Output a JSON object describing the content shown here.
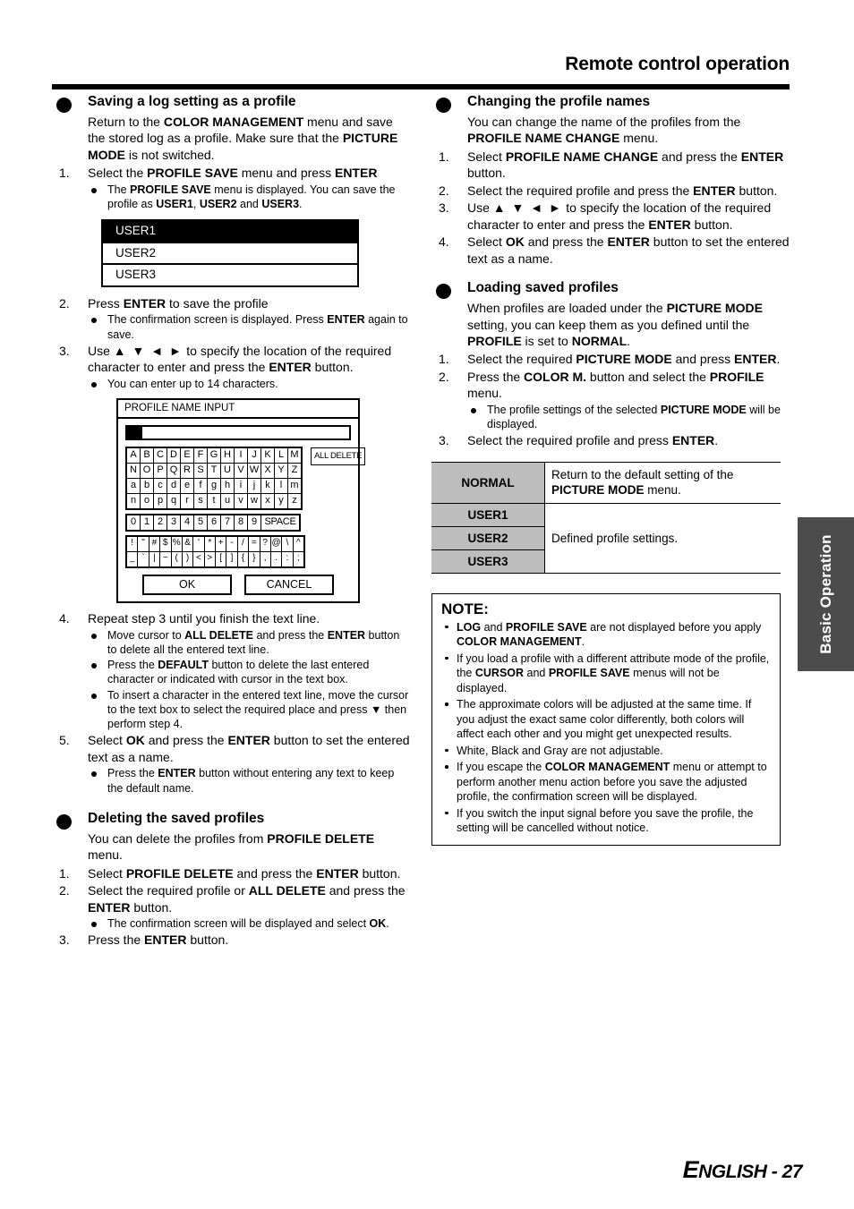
{
  "header": {
    "title": "Remote control operation"
  },
  "footer": {
    "lang_initial": "E",
    "lang_rest": "NGLISH",
    "separator": " - ",
    "page_number": "27"
  },
  "side_tab": {
    "label": "Basic Operation",
    "background": "#4c4c4c",
    "text_color": "#ffffff"
  },
  "left_column": {
    "section_saving": {
      "title": "Saving a log setting as a profile",
      "intro_1": "Return to the ",
      "intro_bold_1": "COLOR MANAGEMENT",
      "intro_2": " menu and save the stored log as a profile. Make sure that the ",
      "intro_bold_2": "PICTURE MODE",
      "intro_3": " is not switched.",
      "step1": {
        "num": "1.",
        "t1": "Select the ",
        "b1": "PROFILE SAVE",
        "t2": " menu and press ",
        "b2": "ENTER",
        "sub1": {
          "t1": "The ",
          "b1": "PROFILE SAVE",
          "t2": " menu is displayed. You can save the profile as ",
          "b2": "USER1",
          "t3": ", ",
          "b3": "USER2",
          "t4": " and ",
          "b4": "USER3",
          "t5": "."
        }
      },
      "osd_profile_save": {
        "rows": [
          "USER1",
          "USER2",
          "USER3"
        ],
        "selected_index": 0
      },
      "step2": {
        "num": "2.",
        "t1": "Press ",
        "b1": "ENTER",
        "t2": " to save the profile",
        "sub1": {
          "t1": "The confirmation screen is displayed. Press ",
          "b1": "ENTER",
          "t2": " again to save."
        }
      },
      "step3": {
        "num": "3.",
        "t1": "Use ",
        "arrows": "▲ ▼ ◄ ►",
        "t2": " to specify the location of the required character to enter and press the ",
        "b1": "ENTER",
        "t3": " button.",
        "sub1": {
          "t1": "You can enter up to 14 characters."
        }
      },
      "step4": {
        "num": "4.",
        "t1": "Repeat step 3 until you finish the text line.",
        "sub1": {
          "t1": "Move cursor to ",
          "b1": "ALL DELETE",
          "t2": " and press the ",
          "b2": "ENTER",
          "t3": " button to delete all the entered text line."
        },
        "sub2": {
          "t1": "Press the ",
          "b1": "DEFAULT",
          "t2": " button to delete the last entered character or indicated with cursor in the text box."
        },
        "sub3": {
          "t1": "To insert a character in the entered text line, move the cursor to the text box to select the required place and press ",
          "arrow": "▼",
          "t2": " then perform step 4."
        }
      },
      "step5": {
        "num": "5.",
        "t1": "Select ",
        "b1": "OK",
        "t2": " and press the ",
        "b2": "ENTER",
        "t3": " button to set the entered text as a name.",
        "sub1": {
          "t1": "Press the ",
          "b1": "ENTER",
          "t2": " button without entering any text to keep the default name."
        }
      }
    },
    "osd_name_input": {
      "title": "PROFILE NAME INPUT",
      "textbox_value": "",
      "cursor_visible": true,
      "alpha_rows": [
        [
          "A",
          "B",
          "C",
          "D",
          "E",
          "F",
          "G",
          "H",
          "I",
          "J",
          "K",
          "L",
          "M"
        ],
        [
          "N",
          "O",
          "P",
          "Q",
          "R",
          "S",
          "T",
          "U",
          "V",
          "W",
          "X",
          "Y",
          "Z"
        ],
        [
          "a",
          "b",
          "c",
          "d",
          "e",
          "f",
          "g",
          "h",
          "i",
          "j",
          "k",
          "l",
          "m"
        ],
        [
          "n",
          "o",
          "p",
          "q",
          "r",
          "s",
          "t",
          "u",
          "v",
          "w",
          "x",
          "y",
          "z"
        ]
      ],
      "num_row": [
        "0",
        "1",
        "2",
        "3",
        "4",
        "5",
        "6",
        "7",
        "8",
        "9"
      ],
      "space_label": "SPACE",
      "symbol_rows": [
        [
          "!",
          "\"",
          "#",
          "$",
          "%",
          "&",
          "'",
          "*",
          "+",
          "-",
          "/",
          "=",
          "?",
          "@",
          "\\",
          "^"
        ],
        [
          "_",
          "`",
          "|",
          "~",
          "(",
          ")",
          "<",
          ">",
          "[",
          "]",
          "{",
          "}",
          ",",
          ".",
          ":",
          ";"
        ]
      ],
      "all_delete_label": "ALL DELETE",
      "ok_label": "OK",
      "cancel_label": "CANCEL"
    },
    "section_deleting": {
      "title": "Deleting the saved profiles",
      "intro_1": "You can delete the profiles from ",
      "intro_bold_1": "PROFILE DELETE",
      "intro_2": " menu.",
      "step1": {
        "num": "1.",
        "t1": "Select ",
        "b1": "PROFILE DELETE",
        "t2": " and press the ",
        "b2": "ENTER",
        "t3": " button."
      },
      "step2": {
        "num": "2.",
        "t1": "Select the required profile or ",
        "b1": "ALL DELETE",
        "t2": " and press the ",
        "b2": "ENTER",
        "t3": " button.",
        "sub1": {
          "t1": "The confirmation screen will be displayed and select ",
          "b1": "OK",
          "t2": "."
        }
      },
      "step3": {
        "num": "3.",
        "t1": "Press the ",
        "b1": "ENTER",
        "t2": " button."
      }
    }
  },
  "right_column": {
    "section_changing": {
      "title": "Changing the profile names",
      "intro_1": "You can change the name of the profiles from the ",
      "intro_bold_1": "PROFILE NAME CHANGE",
      "intro_2": " menu.",
      "step1": {
        "num": "1.",
        "t1": "Select ",
        "b1": "PROFILE NAME CHANGE",
        "t2": " and press the ",
        "b2": "ENTER",
        "t3": " button."
      },
      "step2": {
        "num": "2.",
        "t1": "Select the required profile and press the ",
        "b1": "ENTER",
        "t2": " button."
      },
      "step3": {
        "num": "3.",
        "t1": "Use ",
        "arrows": "▲ ▼ ◄ ►",
        "t2": " to specify the location of the required character to enter and press the ",
        "b1": "ENTER",
        "t3": " button."
      },
      "step4": {
        "num": "4.",
        "t1": "Select ",
        "b1": "OK",
        "t2": " and press the ",
        "b2": "ENTER",
        "t3": " button to set the entered text as a name."
      }
    },
    "section_loading": {
      "title": "Loading saved profiles",
      "intro_1": "When profiles are loaded under the ",
      "intro_bold_1": "PICTURE MODE",
      "intro_2": " setting, you can keep them as you defined until the ",
      "intro_bold_2": "PROFILE",
      "intro_3": " is set to ",
      "intro_bold_3": "NORMAL",
      "intro_4": ".",
      "step1": {
        "num": "1.",
        "t1": "Select the required ",
        "b1": "PICTURE MODE",
        "t2": " and press ",
        "b2": "ENTER",
        "t3": "."
      },
      "step2": {
        "num": "2.",
        "t1": "Press the ",
        "b1": "COLOR M.",
        "t2": " button and select the ",
        "b2": "PROFILE",
        "t3": " menu.",
        "sub1": {
          "t1": "The profile settings of the selected ",
          "b1": "PICTURE MODE",
          "t2": " will be displayed."
        }
      },
      "step3": {
        "num": "3.",
        "t1": "Select the required profile and press ",
        "b1": "ENTER",
        "t2": "."
      }
    },
    "profile_table": {
      "header_bg": "#bdbdbd",
      "rows": [
        {
          "key": "NORMAL",
          "value_t1": "Return to the default setting of the ",
          "value_b1": "PICTURE MODE",
          "value_t2": " menu."
        },
        {
          "key": "USER1",
          "value_t1": "",
          "value_b1": "",
          "value_t2": ""
        },
        {
          "key": "USER2",
          "value_t1": "Defined profile settings.",
          "value_b1": "",
          "value_t2": ""
        },
        {
          "key": "USER3",
          "value_t1": "",
          "value_b1": "",
          "value_t2": ""
        }
      ]
    },
    "note": {
      "title": "NOTE:",
      "items": [
        {
          "b1": "LOG",
          "t1": " and ",
          "b2": "PROFILE SAVE",
          "t2": " are not displayed before you apply ",
          "b3": "COLOR MANAGEMENT",
          "t3": "."
        },
        {
          "t0": "If you load a profile with a different attribute mode of the profile, the ",
          "b1": "CURSOR",
          "t1": " and ",
          "b2": "PROFILE SAVE",
          "t2": " menus will not be displayed."
        },
        {
          "t0": "The approximate colors will be adjusted at the same time. If you adjust the exact same color differently, both colors will affect each other and you might get unexpected results."
        },
        {
          "t0": "White, Black and Gray are not adjustable."
        },
        {
          "t0": "If you escape the ",
          "b1": "COLOR MANAGEMENT",
          "t1": " menu or attempt to perform another menu action before you save the adjusted profile, the confirmation screen will be displayed."
        },
        {
          "t0": "If you switch the input signal before you save the profile, the setting will be cancelled without notice."
        }
      ]
    }
  }
}
